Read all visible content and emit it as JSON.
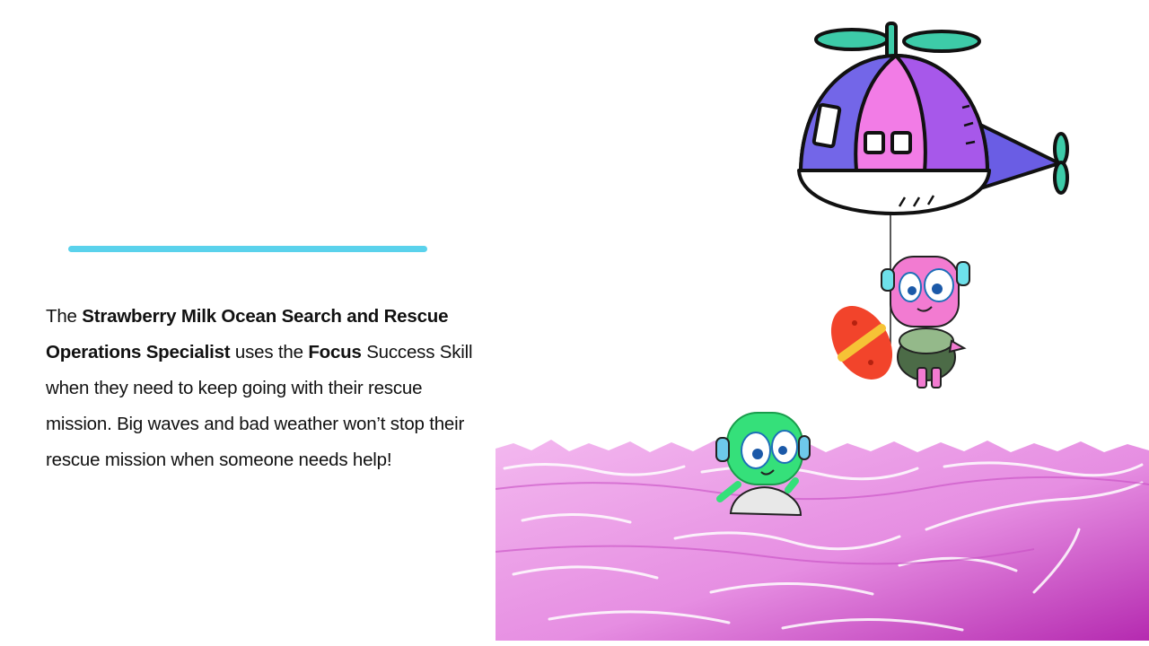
{
  "slide": {
    "paragraph": {
      "t1": "The ",
      "b1": "Strawberry Milk Ocean Search and Rescue Operations Specialist",
      "t2": " uses the ",
      "b2": "Focus",
      "t3": " Success Skill when they need to keep going with their rescue mission. Big waves and bad weather won’t stop their rescue mission when someone needs help!"
    }
  },
  "colors": {
    "accent_line": "#5ad2ec",
    "ocean": "#e48ae0",
    "helicopter_pink": "#f27ce6",
    "helicopter_purple": "#7366e8",
    "rotor_teal": "#3dcba8",
    "pink_robot": "#f27bd1",
    "green_robot": "#35e07a",
    "rescue_board": "#f2442b"
  },
  "icons": [
    "helicopter-illustration",
    "pink-robot-icon",
    "rescue-board-icon",
    "green-robot-icon",
    "ocean-waves"
  ]
}
